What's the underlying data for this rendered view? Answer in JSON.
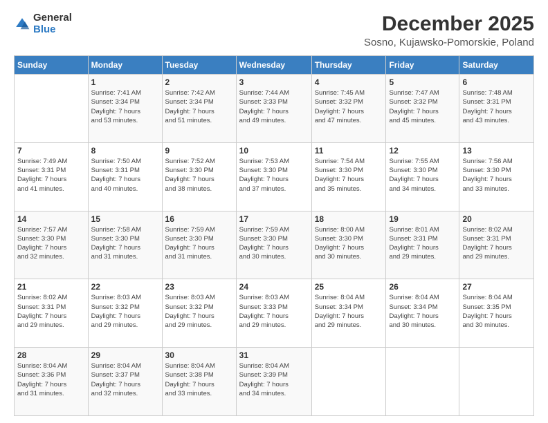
{
  "logo": {
    "general": "General",
    "blue": "Blue"
  },
  "header": {
    "title": "December 2025",
    "subtitle": "Sosno, Kujawsko-Pomorskie, Poland"
  },
  "weekdays": [
    "Sunday",
    "Monday",
    "Tuesday",
    "Wednesday",
    "Thursday",
    "Friday",
    "Saturday"
  ],
  "weeks": [
    [
      {
        "day": "",
        "info": ""
      },
      {
        "day": "1",
        "info": "Sunrise: 7:41 AM\nSunset: 3:34 PM\nDaylight: 7 hours\nand 53 minutes."
      },
      {
        "day": "2",
        "info": "Sunrise: 7:42 AM\nSunset: 3:34 PM\nDaylight: 7 hours\nand 51 minutes."
      },
      {
        "day": "3",
        "info": "Sunrise: 7:44 AM\nSunset: 3:33 PM\nDaylight: 7 hours\nand 49 minutes."
      },
      {
        "day": "4",
        "info": "Sunrise: 7:45 AM\nSunset: 3:32 PM\nDaylight: 7 hours\nand 47 minutes."
      },
      {
        "day": "5",
        "info": "Sunrise: 7:47 AM\nSunset: 3:32 PM\nDaylight: 7 hours\nand 45 minutes."
      },
      {
        "day": "6",
        "info": "Sunrise: 7:48 AM\nSunset: 3:31 PM\nDaylight: 7 hours\nand 43 minutes."
      }
    ],
    [
      {
        "day": "7",
        "info": "Sunrise: 7:49 AM\nSunset: 3:31 PM\nDaylight: 7 hours\nand 41 minutes."
      },
      {
        "day": "8",
        "info": "Sunrise: 7:50 AM\nSunset: 3:31 PM\nDaylight: 7 hours\nand 40 minutes."
      },
      {
        "day": "9",
        "info": "Sunrise: 7:52 AM\nSunset: 3:30 PM\nDaylight: 7 hours\nand 38 minutes."
      },
      {
        "day": "10",
        "info": "Sunrise: 7:53 AM\nSunset: 3:30 PM\nDaylight: 7 hours\nand 37 minutes."
      },
      {
        "day": "11",
        "info": "Sunrise: 7:54 AM\nSunset: 3:30 PM\nDaylight: 7 hours\nand 35 minutes."
      },
      {
        "day": "12",
        "info": "Sunrise: 7:55 AM\nSunset: 3:30 PM\nDaylight: 7 hours\nand 34 minutes."
      },
      {
        "day": "13",
        "info": "Sunrise: 7:56 AM\nSunset: 3:30 PM\nDaylight: 7 hours\nand 33 minutes."
      }
    ],
    [
      {
        "day": "14",
        "info": "Sunrise: 7:57 AM\nSunset: 3:30 PM\nDaylight: 7 hours\nand 32 minutes."
      },
      {
        "day": "15",
        "info": "Sunrise: 7:58 AM\nSunset: 3:30 PM\nDaylight: 7 hours\nand 31 minutes."
      },
      {
        "day": "16",
        "info": "Sunrise: 7:59 AM\nSunset: 3:30 PM\nDaylight: 7 hours\nand 31 minutes."
      },
      {
        "day": "17",
        "info": "Sunrise: 7:59 AM\nSunset: 3:30 PM\nDaylight: 7 hours\nand 30 minutes."
      },
      {
        "day": "18",
        "info": "Sunrise: 8:00 AM\nSunset: 3:30 PM\nDaylight: 7 hours\nand 30 minutes."
      },
      {
        "day": "19",
        "info": "Sunrise: 8:01 AM\nSunset: 3:31 PM\nDaylight: 7 hours\nand 29 minutes."
      },
      {
        "day": "20",
        "info": "Sunrise: 8:02 AM\nSunset: 3:31 PM\nDaylight: 7 hours\nand 29 minutes."
      }
    ],
    [
      {
        "day": "21",
        "info": "Sunrise: 8:02 AM\nSunset: 3:31 PM\nDaylight: 7 hours\nand 29 minutes."
      },
      {
        "day": "22",
        "info": "Sunrise: 8:03 AM\nSunset: 3:32 PM\nDaylight: 7 hours\nand 29 minutes."
      },
      {
        "day": "23",
        "info": "Sunrise: 8:03 AM\nSunset: 3:32 PM\nDaylight: 7 hours\nand 29 minutes."
      },
      {
        "day": "24",
        "info": "Sunrise: 8:03 AM\nSunset: 3:33 PM\nDaylight: 7 hours\nand 29 minutes."
      },
      {
        "day": "25",
        "info": "Sunrise: 8:04 AM\nSunset: 3:34 PM\nDaylight: 7 hours\nand 29 minutes."
      },
      {
        "day": "26",
        "info": "Sunrise: 8:04 AM\nSunset: 3:34 PM\nDaylight: 7 hours\nand 30 minutes."
      },
      {
        "day": "27",
        "info": "Sunrise: 8:04 AM\nSunset: 3:35 PM\nDaylight: 7 hours\nand 30 minutes."
      }
    ],
    [
      {
        "day": "28",
        "info": "Sunrise: 8:04 AM\nSunset: 3:36 PM\nDaylight: 7 hours\nand 31 minutes."
      },
      {
        "day": "29",
        "info": "Sunrise: 8:04 AM\nSunset: 3:37 PM\nDaylight: 7 hours\nand 32 minutes."
      },
      {
        "day": "30",
        "info": "Sunrise: 8:04 AM\nSunset: 3:38 PM\nDaylight: 7 hours\nand 33 minutes."
      },
      {
        "day": "31",
        "info": "Sunrise: 8:04 AM\nSunset: 3:39 PM\nDaylight: 7 hours\nand 34 minutes."
      },
      {
        "day": "",
        "info": ""
      },
      {
        "day": "",
        "info": ""
      },
      {
        "day": "",
        "info": ""
      }
    ]
  ]
}
